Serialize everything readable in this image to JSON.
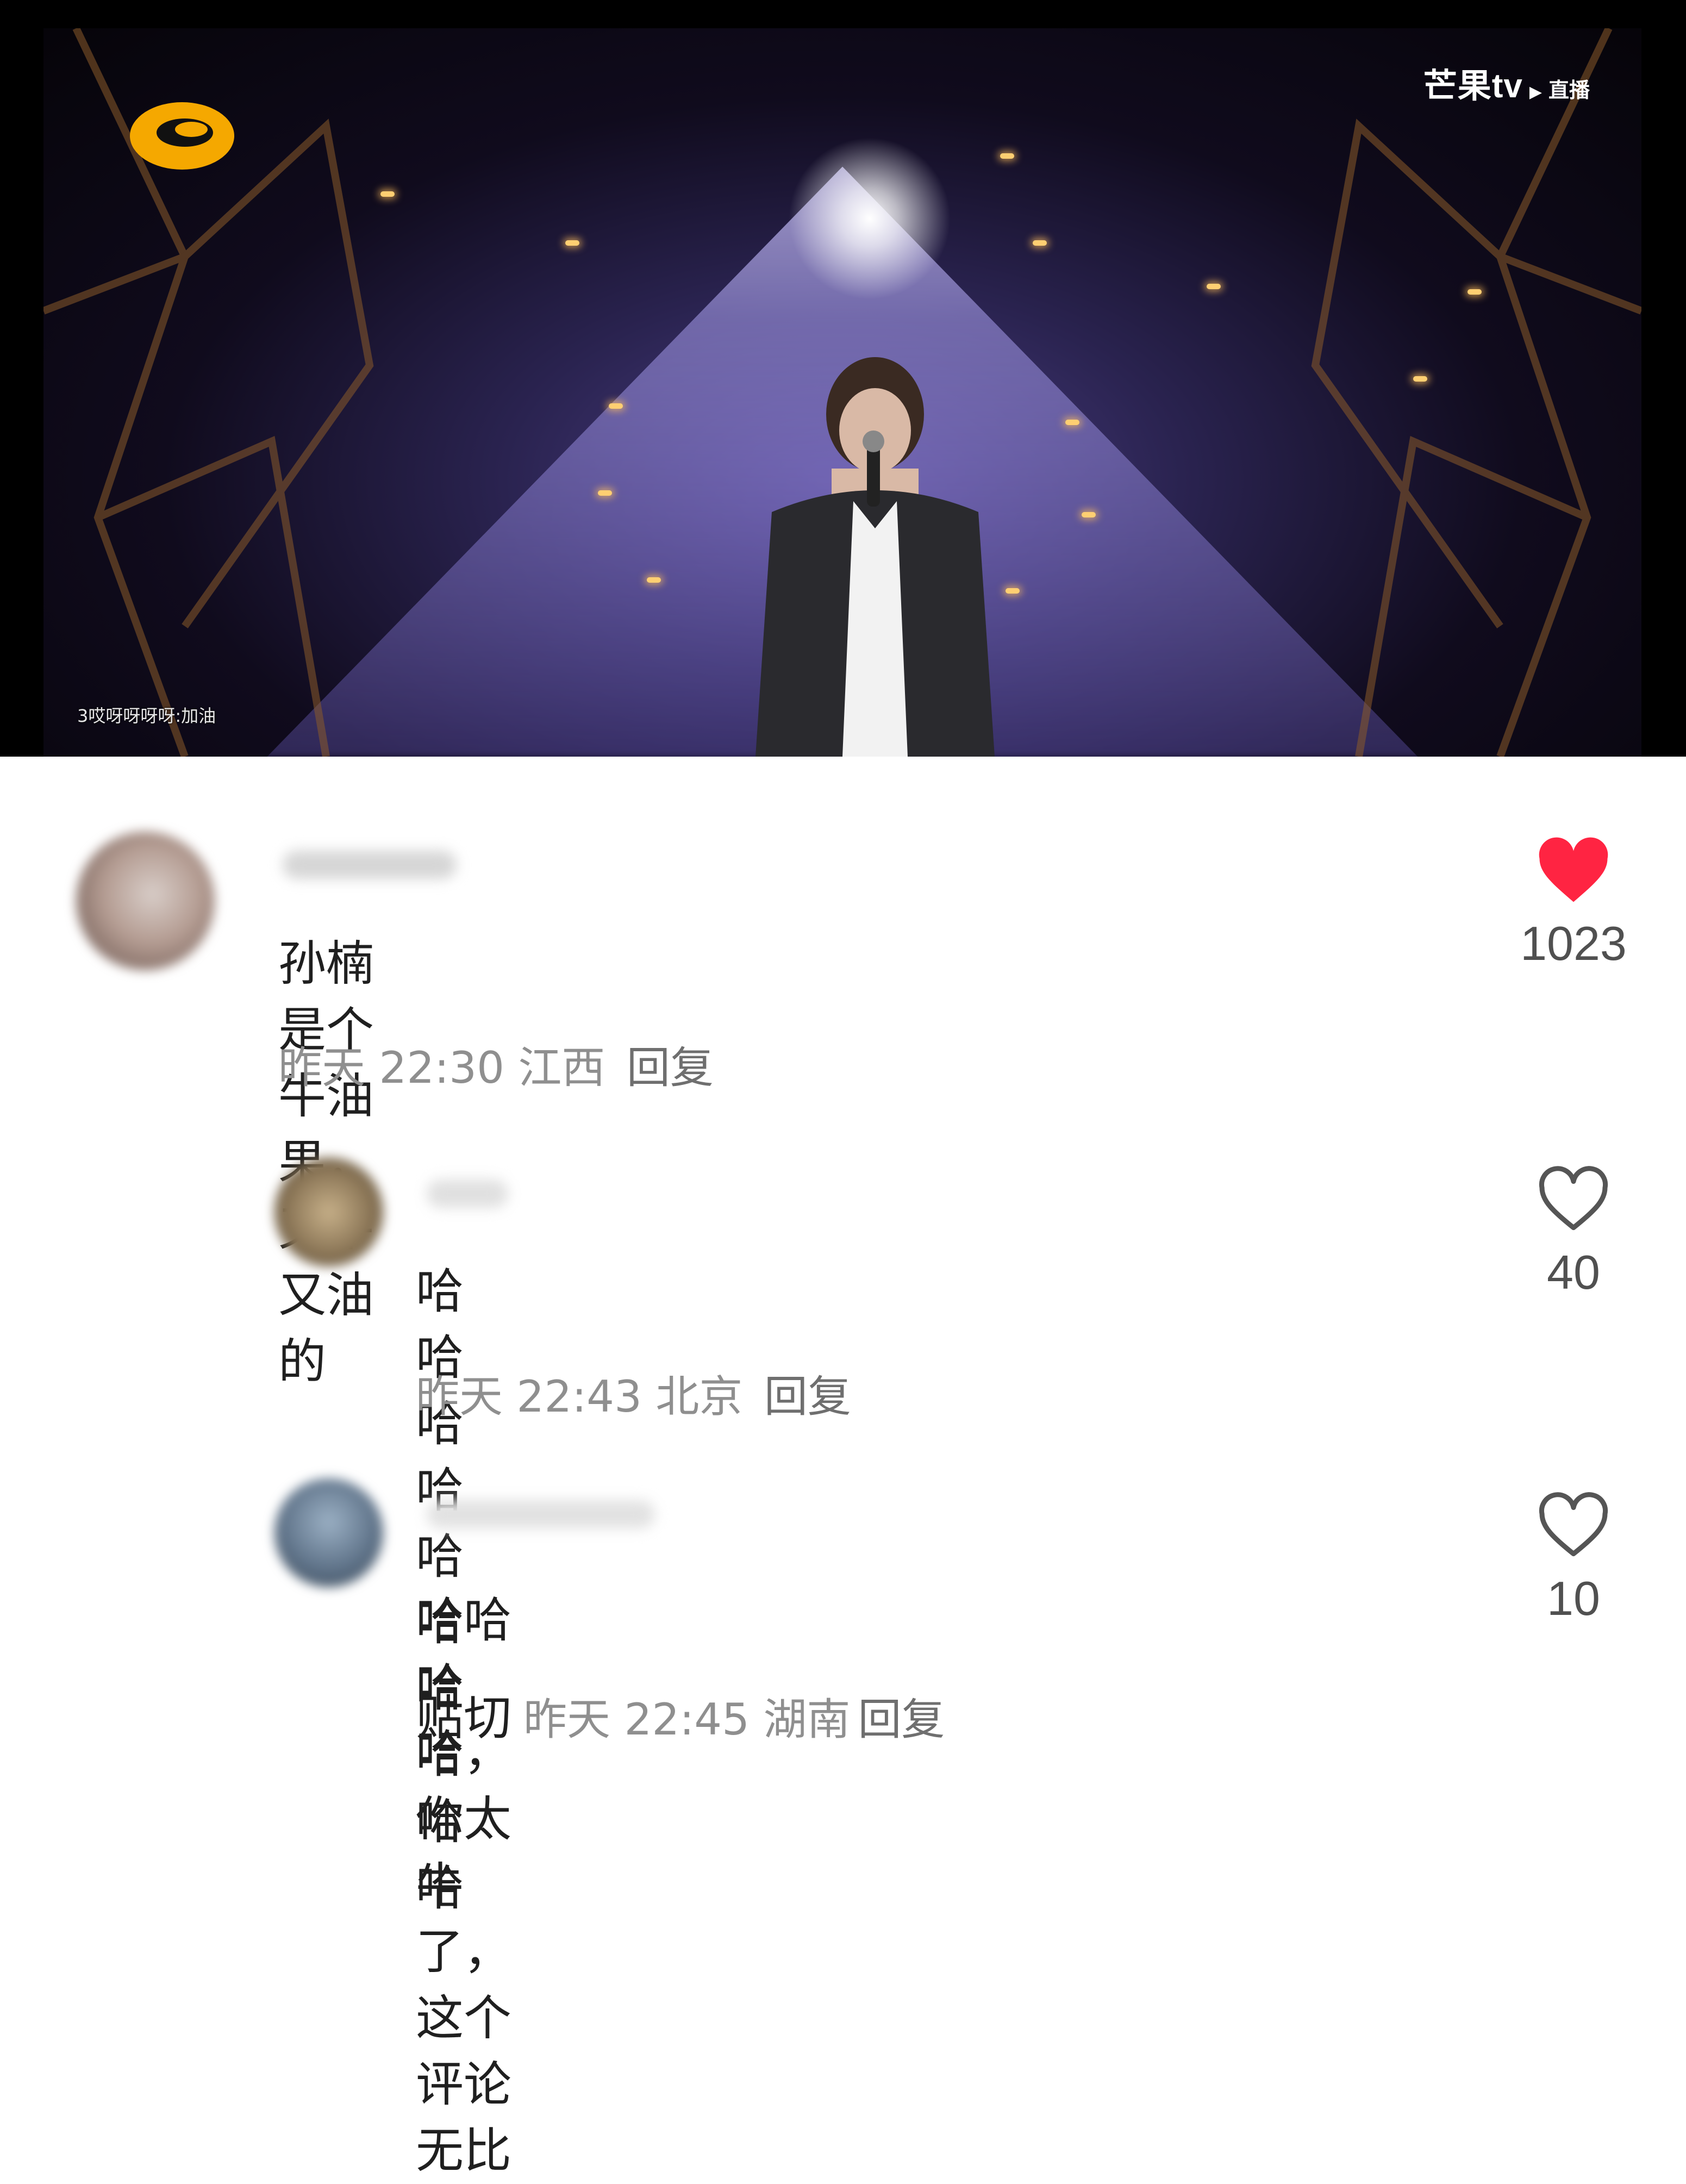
{
  "video": {
    "brand_name": "芒果tv",
    "brand_play_glyph": "▶",
    "brand_live": "直播",
    "danmaku": "3哎呀呀呀呀:加油"
  },
  "comments": [
    {
      "text": "孙楠是个牛油果，又牛又油的",
      "time": "昨天 22:30",
      "location": "江西",
      "reply_label": "回复",
      "likes": "1023",
      "liked": true,
      "avatar_color": "#b9a7a2"
    },
    {
      "text": "哈哈哈哈哈哈哈哈哈哈",
      "time": "昨天 22:43",
      "location": "北京",
      "reply_label": "回复",
      "likes": "40",
      "liked": false,
      "avatar_color": "#9b8460"
    },
    {
      "text_line1": "哈哈哈哈，你太牛了，这个评论无比",
      "text_line2": "贴切",
      "time": "昨天 22:45",
      "location": "湖南",
      "reply_label": "回复",
      "likes": "10",
      "liked": false,
      "avatar_color": "#5f7388"
    }
  ],
  "colors": {
    "like_active": "#ff2442",
    "like_inactive": "#555555",
    "meta_text": "#8f8f8f"
  },
  "icons": {
    "like": "heart-icon",
    "station_logo": "hunan-tv-logo",
    "play": "play-triangle-icon"
  }
}
